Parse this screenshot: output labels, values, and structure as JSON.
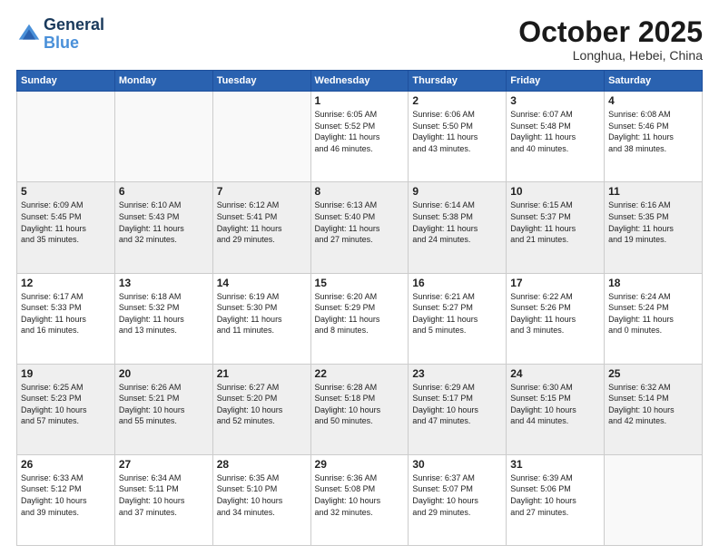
{
  "header": {
    "logo_line1": "General",
    "logo_line2": "Blue",
    "month": "October 2025",
    "location": "Longhua, Hebei, China"
  },
  "weekdays": [
    "Sunday",
    "Monday",
    "Tuesday",
    "Wednesday",
    "Thursday",
    "Friday",
    "Saturday"
  ],
  "weeks": [
    [
      {
        "day": "",
        "info": ""
      },
      {
        "day": "",
        "info": ""
      },
      {
        "day": "",
        "info": ""
      },
      {
        "day": "1",
        "info": "Sunrise: 6:05 AM\nSunset: 5:52 PM\nDaylight: 11 hours\nand 46 minutes."
      },
      {
        "day": "2",
        "info": "Sunrise: 6:06 AM\nSunset: 5:50 PM\nDaylight: 11 hours\nand 43 minutes."
      },
      {
        "day": "3",
        "info": "Sunrise: 6:07 AM\nSunset: 5:48 PM\nDaylight: 11 hours\nand 40 minutes."
      },
      {
        "day": "4",
        "info": "Sunrise: 6:08 AM\nSunset: 5:46 PM\nDaylight: 11 hours\nand 38 minutes."
      }
    ],
    [
      {
        "day": "5",
        "info": "Sunrise: 6:09 AM\nSunset: 5:45 PM\nDaylight: 11 hours\nand 35 minutes."
      },
      {
        "day": "6",
        "info": "Sunrise: 6:10 AM\nSunset: 5:43 PM\nDaylight: 11 hours\nand 32 minutes."
      },
      {
        "day": "7",
        "info": "Sunrise: 6:12 AM\nSunset: 5:41 PM\nDaylight: 11 hours\nand 29 minutes."
      },
      {
        "day": "8",
        "info": "Sunrise: 6:13 AM\nSunset: 5:40 PM\nDaylight: 11 hours\nand 27 minutes."
      },
      {
        "day": "9",
        "info": "Sunrise: 6:14 AM\nSunset: 5:38 PM\nDaylight: 11 hours\nand 24 minutes."
      },
      {
        "day": "10",
        "info": "Sunrise: 6:15 AM\nSunset: 5:37 PM\nDaylight: 11 hours\nand 21 minutes."
      },
      {
        "day": "11",
        "info": "Sunrise: 6:16 AM\nSunset: 5:35 PM\nDaylight: 11 hours\nand 19 minutes."
      }
    ],
    [
      {
        "day": "12",
        "info": "Sunrise: 6:17 AM\nSunset: 5:33 PM\nDaylight: 11 hours\nand 16 minutes."
      },
      {
        "day": "13",
        "info": "Sunrise: 6:18 AM\nSunset: 5:32 PM\nDaylight: 11 hours\nand 13 minutes."
      },
      {
        "day": "14",
        "info": "Sunrise: 6:19 AM\nSunset: 5:30 PM\nDaylight: 11 hours\nand 11 minutes."
      },
      {
        "day": "15",
        "info": "Sunrise: 6:20 AM\nSunset: 5:29 PM\nDaylight: 11 hours\nand 8 minutes."
      },
      {
        "day": "16",
        "info": "Sunrise: 6:21 AM\nSunset: 5:27 PM\nDaylight: 11 hours\nand 5 minutes."
      },
      {
        "day": "17",
        "info": "Sunrise: 6:22 AM\nSunset: 5:26 PM\nDaylight: 11 hours\nand 3 minutes."
      },
      {
        "day": "18",
        "info": "Sunrise: 6:24 AM\nSunset: 5:24 PM\nDaylight: 11 hours\nand 0 minutes."
      }
    ],
    [
      {
        "day": "19",
        "info": "Sunrise: 6:25 AM\nSunset: 5:23 PM\nDaylight: 10 hours\nand 57 minutes."
      },
      {
        "day": "20",
        "info": "Sunrise: 6:26 AM\nSunset: 5:21 PM\nDaylight: 10 hours\nand 55 minutes."
      },
      {
        "day": "21",
        "info": "Sunrise: 6:27 AM\nSunset: 5:20 PM\nDaylight: 10 hours\nand 52 minutes."
      },
      {
        "day": "22",
        "info": "Sunrise: 6:28 AM\nSunset: 5:18 PM\nDaylight: 10 hours\nand 50 minutes."
      },
      {
        "day": "23",
        "info": "Sunrise: 6:29 AM\nSunset: 5:17 PM\nDaylight: 10 hours\nand 47 minutes."
      },
      {
        "day": "24",
        "info": "Sunrise: 6:30 AM\nSunset: 5:15 PM\nDaylight: 10 hours\nand 44 minutes."
      },
      {
        "day": "25",
        "info": "Sunrise: 6:32 AM\nSunset: 5:14 PM\nDaylight: 10 hours\nand 42 minutes."
      }
    ],
    [
      {
        "day": "26",
        "info": "Sunrise: 6:33 AM\nSunset: 5:12 PM\nDaylight: 10 hours\nand 39 minutes."
      },
      {
        "day": "27",
        "info": "Sunrise: 6:34 AM\nSunset: 5:11 PM\nDaylight: 10 hours\nand 37 minutes."
      },
      {
        "day": "28",
        "info": "Sunrise: 6:35 AM\nSunset: 5:10 PM\nDaylight: 10 hours\nand 34 minutes."
      },
      {
        "day": "29",
        "info": "Sunrise: 6:36 AM\nSunset: 5:08 PM\nDaylight: 10 hours\nand 32 minutes."
      },
      {
        "day": "30",
        "info": "Sunrise: 6:37 AM\nSunset: 5:07 PM\nDaylight: 10 hours\nand 29 minutes."
      },
      {
        "day": "31",
        "info": "Sunrise: 6:39 AM\nSunset: 5:06 PM\nDaylight: 10 hours\nand 27 minutes."
      },
      {
        "day": "",
        "info": ""
      }
    ]
  ]
}
